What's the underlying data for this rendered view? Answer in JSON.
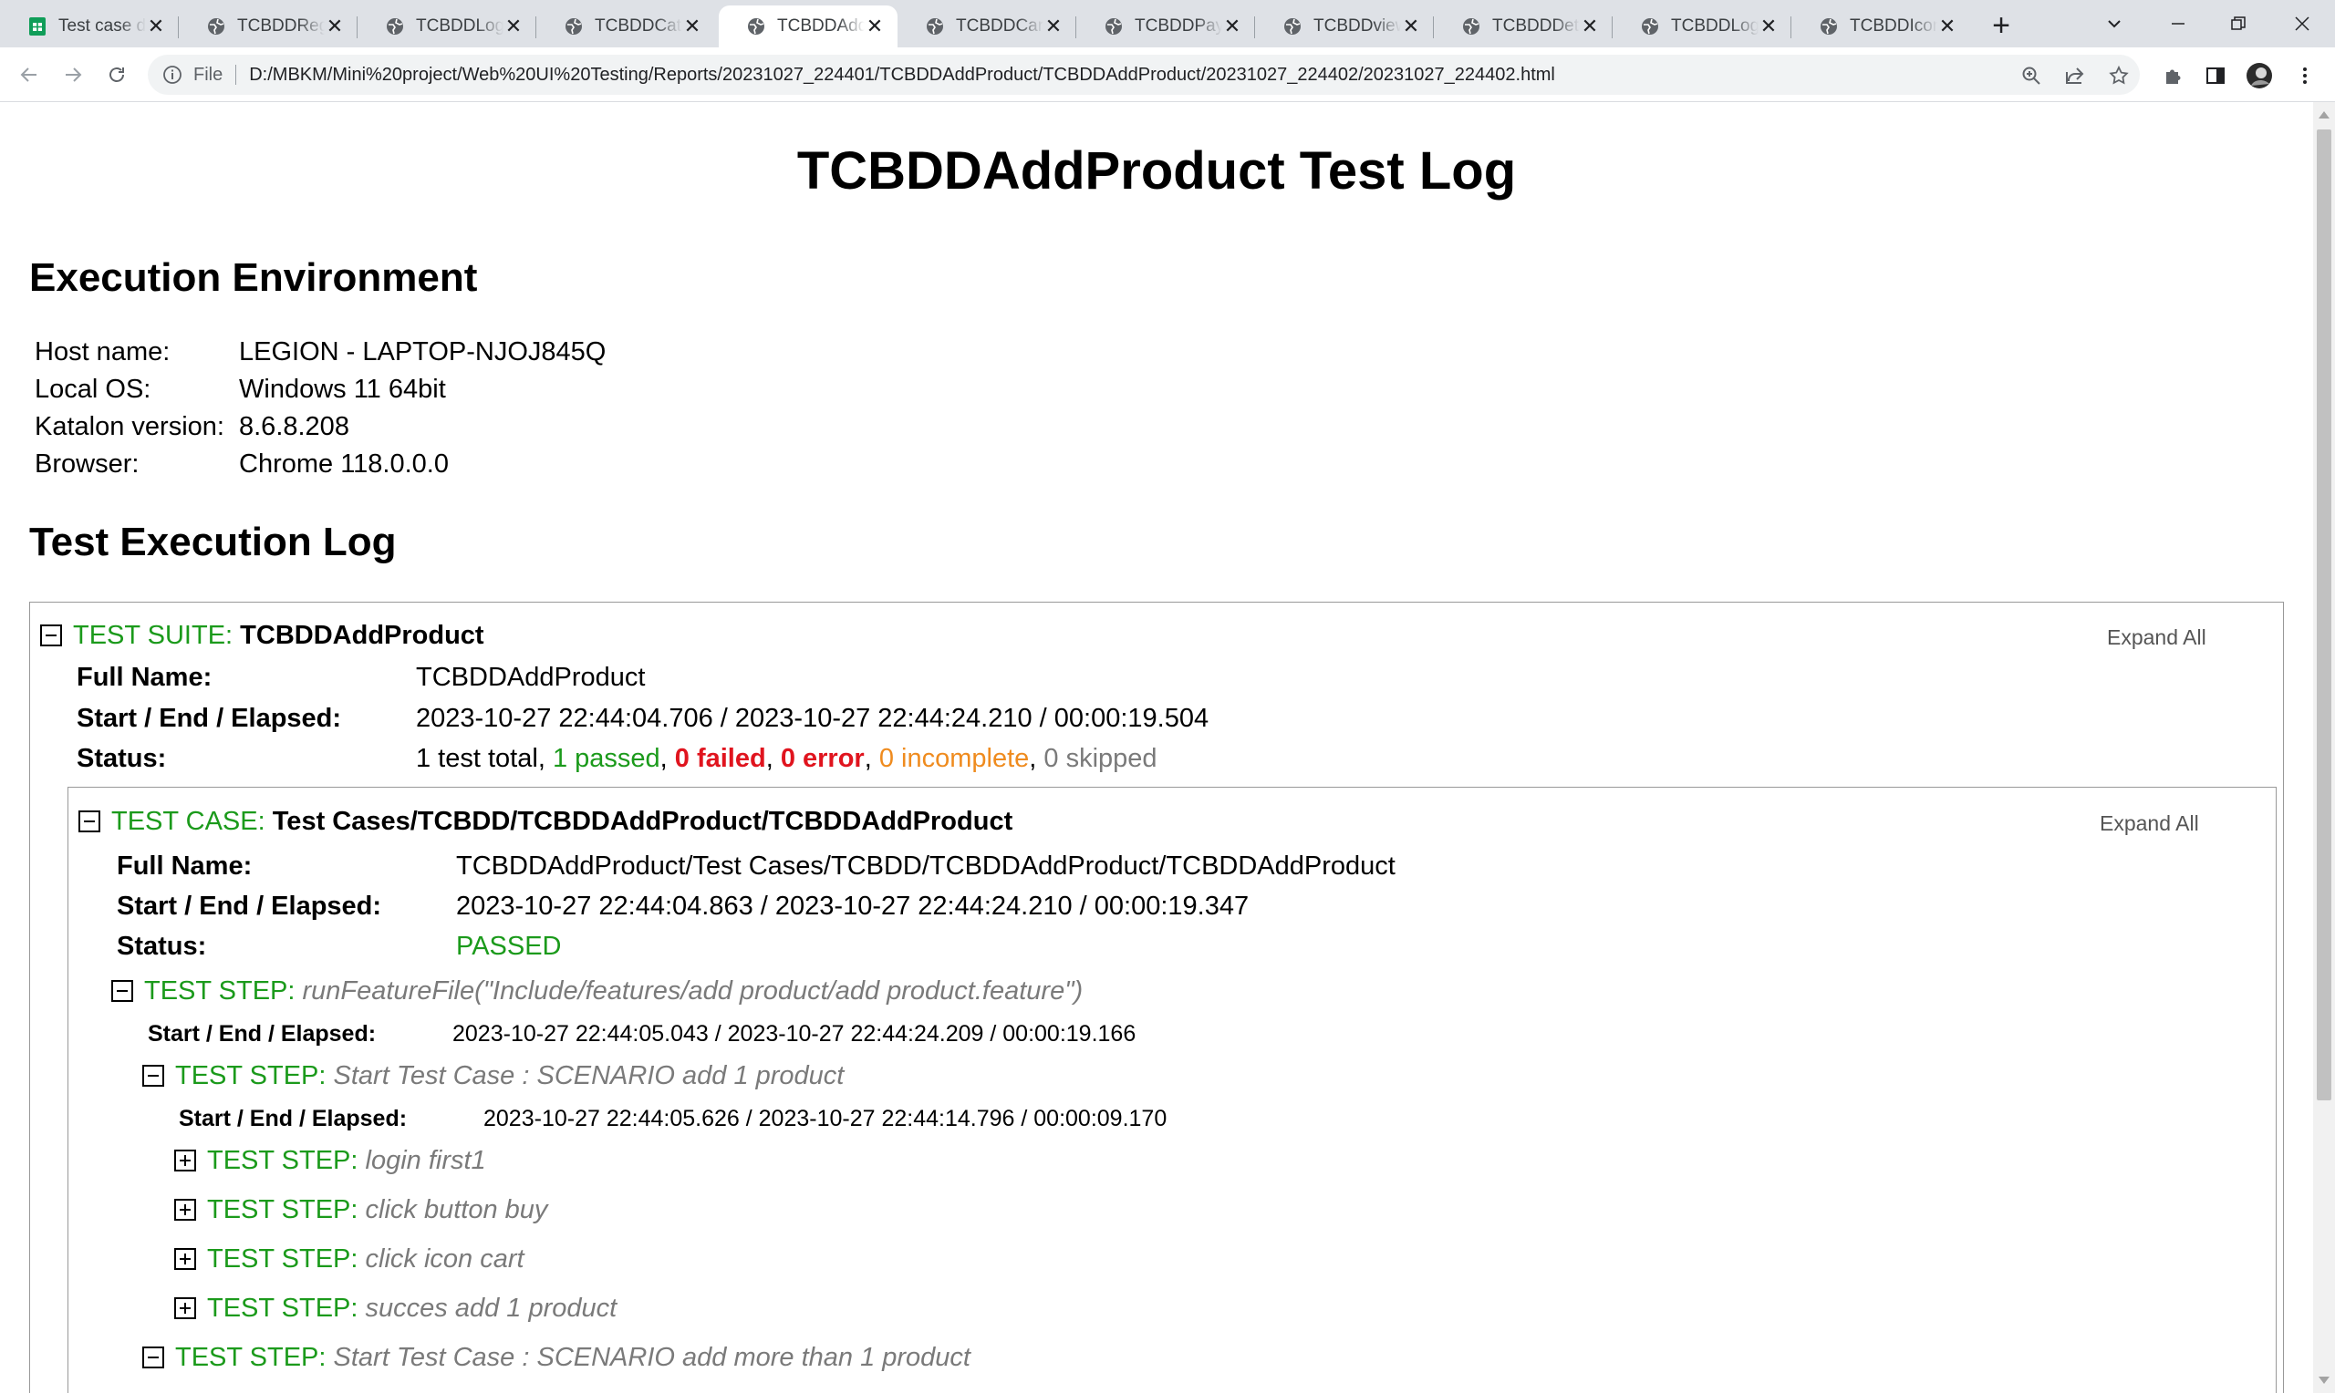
{
  "browser": {
    "tabs": [
      {
        "title": "Test case do",
        "icon": "sheets-icon",
        "active": false
      },
      {
        "title": "TCBDDRegi",
        "icon": "globe-icon",
        "active": false
      },
      {
        "title": "TCBDDLogi",
        "icon": "globe-icon",
        "active": false
      },
      {
        "title": "TCBDDCate",
        "icon": "globe-icon",
        "active": false
      },
      {
        "title": "TCBDDAddi",
        "icon": "globe-icon",
        "active": true
      },
      {
        "title": "TCBDDCart",
        "icon": "globe-icon",
        "active": false
      },
      {
        "title": "TCBDDPaym",
        "icon": "globe-icon",
        "active": false
      },
      {
        "title": "TCBDDview",
        "icon": "globe-icon",
        "active": false
      },
      {
        "title": "TCBDDDeta",
        "icon": "globe-icon",
        "active": false
      },
      {
        "title": "TCBDDLogo",
        "icon": "globe-icon",
        "active": false
      },
      {
        "title": "TCBDDIcon",
        "icon": "globe-icon",
        "active": false
      }
    ],
    "address": {
      "scheme_label": "File",
      "url": "D:/MBKM/Mini%20project/Web%20UI%20Testing/Reports/20231027_224401/TCBDDAddProduct/TCBDDAddProduct/20231027_224402/20231027_224402.html"
    }
  },
  "page": {
    "title": "TCBDDAddProduct Test Log",
    "env_heading": "Execution Environment",
    "env": [
      {
        "key": "Host name:",
        "value": "LEGION - LAPTOP-NJOJ845Q"
      },
      {
        "key": "Local OS:",
        "value": "Windows 11 64bit"
      },
      {
        "key": "Katalon version:",
        "value": "8.6.8.208"
      },
      {
        "key": "Browser:",
        "value": "Chrome 118.0.0.0"
      }
    ],
    "log_heading": "Test Execution Log",
    "suite": {
      "label": "TEST SUITE:",
      "name": "TCBDDAddProduct",
      "expand_all": "Expand All",
      "full_name_key": "Full Name:",
      "full_name": "TCBDDAddProduct",
      "timing_key": "Start / End / Elapsed:",
      "timing": "2023-10-27 22:44:04.706 / 2023-10-27 22:44:24.210 / 00:00:19.504",
      "status_key": "Status:",
      "status": {
        "total": "1 test total",
        "sep": ", ",
        "passed": "1 passed",
        "failed": "0 failed",
        "error": "0 error",
        "incomplete": "0 incomplete",
        "skipped": "0 skipped"
      }
    },
    "case": {
      "label": "TEST CASE:",
      "name": "Test Cases/TCBDD/TCBDDAddProduct/TCBDDAddProduct",
      "expand_all": "Expand All",
      "full_name_key": "Full Name:",
      "full_name": "TCBDDAddProduct/Test Cases/TCBDD/TCBDDAddProduct/TCBDDAddProduct",
      "timing_key": "Start / End / Elapsed:",
      "timing": "2023-10-27 22:44:04.863 / 2023-10-27 22:44:24.210 / 00:00:19.347",
      "status_key": "Status:",
      "status": "PASSED"
    },
    "step_label": "TEST STEP:",
    "steps": {
      "feature": {
        "name": "runFeatureFile(\"Include/features/add product/add product.feature\")",
        "timing_key": "Start / End / Elapsed:",
        "timing": "2023-10-27 22:44:05.043 / 2023-10-27 22:44:24.209 / 00:00:19.166"
      },
      "scenario1": {
        "name": "Start Test Case : SCENARIO add 1 product",
        "timing_key": "Start / End / Elapsed:",
        "timing": "2023-10-27 22:44:05.626 / 2023-10-27 22:44:14.796 / 00:00:09.170"
      },
      "sub": [
        {
          "name": "login first1"
        },
        {
          "name": "click button buy"
        },
        {
          "name": "click icon cart"
        },
        {
          "name": "succes add 1 product"
        }
      ],
      "scenario2": {
        "name": "Start Test Case : SCENARIO add more than 1 product"
      }
    }
  },
  "colors": {
    "label_green": "#1b9a1b",
    "failed_red": "#e0141e",
    "incomplete_orange": "#ef8b1e",
    "muted_gray": "#7a7a7a"
  }
}
